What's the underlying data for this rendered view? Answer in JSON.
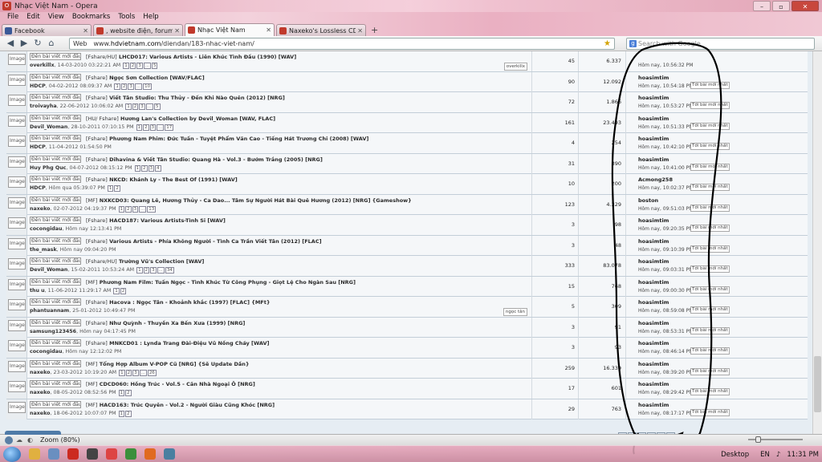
{
  "window": {
    "title": "Nhạc Việt Nam - Opera",
    "controls": {
      "minimize": "–",
      "maximize": "▫",
      "close": "✕"
    }
  },
  "menu": [
    "File",
    "Edit",
    "View",
    "Bookmarks",
    "Tools",
    "Help"
  ],
  "tabs": [
    {
      "label": "Facebook",
      "color": "#3b5998",
      "active": false
    },
    {
      "label": ", website điện, forum đ...",
      "color": "#c0392b",
      "active": false
    },
    {
      "label": "Nhạc Việt Nam",
      "color": "#c0392b",
      "active": true
    },
    {
      "label": "Naxeko's Lossless CDs ...",
      "color": "#c0392b",
      "active": false
    }
  ],
  "newtab": "+",
  "address": {
    "scheme_label": "Web",
    "url_prefix": "www.",
    "url_domain": "hdvietnam.com",
    "url_path": "/diendan/183-nhac-viet-nam/",
    "search_placeholder": "Search with Google"
  },
  "forum": {
    "new_post_label": "Đến bài viết mới đầu tiên",
    "last_post_box": "Tới bài mới nhất",
    "rows": [
      {
        "icon": "Image",
        "prefix": "[Fshare/HU]",
        "title": "LHCD017: Various Artists - Liên Khúc Tình Đầu (1990) [WAV]",
        "author": "overkillx",
        "date": "14-03-2010 03:22:21 AM",
        "pages": [
          "1",
          "2",
          "3",
          "...",
          "5"
        ],
        "tag": "overkillx",
        "replies": "45",
        "views": "6.337",
        "lp_user": "",
        "lp_time": "Hôm nay, 10:56:32 PM"
      },
      {
        "icon": "Image",
        "prefix": "[Fshare]",
        "title": "Ngọc Sơn Collection [WAV/FLAC]",
        "author": "HDCP",
        "date": "04-02-2012 08:09:37 AM",
        "pages": [
          "1",
          "2",
          "3",
          "...",
          "10"
        ],
        "tag": "",
        "replies": "90",
        "views": "12.092",
        "lp_user": "hoasimtim",
        "lp_time": "Hôm nay, 10:54:18 PM"
      },
      {
        "icon": "Image",
        "prefix": "[Fshare]",
        "title": "Viết Tân Studio: Thu Thủy - Đến Khi Nào Quên (2012) [NRG]",
        "author": "troivayha",
        "date": "22-06-2012 10:06:02 AM",
        "pages": [
          "1",
          "2",
          "3",
          "...",
          "5"
        ],
        "tag": "",
        "replies": "72",
        "views": "1.866",
        "lp_user": "hoasimtim",
        "lp_time": "Hôm nay, 10:53:27 PM"
      },
      {
        "icon": "Image",
        "prefix": "[HU/ Fshare]",
        "title": "Hương Lan's Collection by Devil_Woman [WAV, FLAC]",
        "author": "Devil_Woman",
        "date": "28-10-2011 07:10:15 PM",
        "pages": [
          "1",
          "2",
          "3",
          "...",
          "17"
        ],
        "tag": "",
        "replies": "161",
        "views": "23.493",
        "lp_user": "hoasimtim",
        "lp_time": "Hôm nay, 10:51:33 PM"
      },
      {
        "icon": "Image",
        "prefix": "[Fshare]",
        "title": "Phương Nam Phim: Đức Tuấn - Tuyệt Phẩm Văn Cao - Tiếng Hát Trương Chi (2008) [WAV]",
        "author": "HDCP",
        "date": "11-04-2012 01:54:50 PM",
        "pages": [],
        "tag": "",
        "replies": "4",
        "views": "254",
        "lp_user": "hoasimtim",
        "lp_time": "Hôm nay, 10:42:10 PM"
      },
      {
        "icon": "Image",
        "prefix": "[Fshare]",
        "title": "Dihavina & Viết Tân Studio: Quang Hà - Vol.3 - Bướm Trắng (2005) [NRG]",
        "author": "Huy Phg Quc",
        "date": "04-07-2012 08:15:12 PM",
        "pages": [
          "1",
          "2",
          "3",
          "4"
        ],
        "tag": "",
        "replies": "31",
        "views": "390",
        "lp_user": "hoasimtim",
        "lp_time": "Hôm nay, 10:41:00 PM"
      },
      {
        "icon": "Image",
        "prefix": "[Fshare]",
        "title": "NKCD: Khánh Ly - The Best Of (1991) [WAV]",
        "author": "HDCP",
        "date": "Hôm qua 05:39:07 PM",
        "pages": [
          "1",
          "2"
        ],
        "tag": "",
        "replies": "10",
        "views": "200",
        "lp_user": "Acmong258",
        "lp_time": "Hôm nay, 10:02:37 PM"
      },
      {
        "icon": "Image",
        "prefix": "[MF]",
        "title": "NXKCD03: Quang Lê, Hương Thủy - Ca Dao... Tâm Sự Người Hát Bài Quê Hương (2012) [NRG] {Gameshow}",
        "author": "naxeko",
        "date": "02-07-2012 04:19:37 PM",
        "pages": [
          "1",
          "2",
          "3",
          "...",
          "13"
        ],
        "tag": "",
        "replies": "123",
        "views": "4.329",
        "lp_user": "boston",
        "lp_time": "Hôm nay, 09:51:03 PM"
      },
      {
        "icon": "Image",
        "prefix": "[Fshare]",
        "title": "HACD187: Various Artists-Tình Si [WAV]",
        "author": "cocongidau",
        "date": "Hôm nay 12:13:41 PM",
        "pages": [],
        "tag": "",
        "replies": "3",
        "views": "98",
        "lp_user": "hoasimtim",
        "lp_time": "Hôm nay, 09:20:35 PM"
      },
      {
        "icon": "Image",
        "prefix": "[Fshare]",
        "title": "Various Artists - Phía Không Người - Tình Ca Trần Viết Tân (2012) [FLAC]",
        "author": "the_mask",
        "date": "Hôm nay 09:04:20 PM",
        "pages": [],
        "tag": "",
        "replies": "3",
        "views": "48",
        "lp_user": "hoasimtim",
        "lp_time": "Hôm nay, 09:10:39 PM"
      },
      {
        "icon": "Image",
        "prefix": "[Fshare/HU]",
        "title": "Trường Vũ's Collection [WAV]",
        "author": "Devil_Woman",
        "date": "15-02-2011 10:53:24 AM",
        "pages": [
          "1",
          "2",
          "3",
          "...",
          "34"
        ],
        "tag": "",
        "replies": "333",
        "views": "83.078",
        "lp_user": "hoasimtim",
        "lp_time": "Hôm nay, 09:03:31 PM"
      },
      {
        "icon": "Image",
        "prefix": "[MF]",
        "title": "Phương Nam Film: Tuấn Ngọc - Tình Khúc Từ Công Phụng - Giọt Lệ Cho Ngàn Sau [NRG]",
        "author": "thu u",
        "date": "11-06-2012 11:29:17 AM",
        "pages": [
          "1",
          "2"
        ],
        "tag": "",
        "replies": "15",
        "views": "768",
        "lp_user": "hoasimtim",
        "lp_time": "Hôm nay, 09:00:30 PM"
      },
      {
        "icon": "Image",
        "prefix": "[Fshare]",
        "title": "Hacova : Ngọc Tân - Khoảnh khắc (1997) [FLAC] {MFt}",
        "author": "phantuannam",
        "date": "25-01-2012 10:49:47 PM",
        "pages": [],
        "tag": "ngọc tân",
        "replies": "5",
        "views": "309",
        "lp_user": "hoasimtim",
        "lp_time": "Hôm nay, 08:59:08 PM"
      },
      {
        "icon": "Image",
        "prefix": "[Fshare]",
        "title": "Như Quỳnh - Thuyền Xa Bến Xưa (1999) [NRG]",
        "author": "samsung123456",
        "date": "Hôm nay 04:17:45 PM",
        "pages": [],
        "tag": "",
        "replies": "3",
        "views": "91",
        "lp_user": "hoasimtim",
        "lp_time": "Hôm nay, 08:53:31 PM"
      },
      {
        "icon": "Image",
        "prefix": "[Fshare]",
        "title": "MNKCD01 : Lynda Trang Đài-Điệu Vũ Nồng Cháy [WAV]",
        "author": "cocongidau",
        "date": "Hôm nay 12:12:02 PM",
        "pages": [],
        "tag": "",
        "replies": "3",
        "views": "93",
        "lp_user": "hoasimtim",
        "lp_time": "Hôm nay, 08:46:14 PM"
      },
      {
        "icon": "Image",
        "prefix": "[MF]",
        "title": "Tổng Hợp Album V-POP Cũ [NRG] {Sẽ Update Dần}",
        "author": "naxeko",
        "date": "23-03-2012 10:19:20 AM",
        "pages": [
          "1",
          "2",
          "3",
          "...",
          "26"
        ],
        "tag": "",
        "replies": "259",
        "views": "16.339",
        "lp_user": "hoasimtim",
        "lp_time": "Hôm nay, 08:39:20 PM"
      },
      {
        "icon": "Image",
        "prefix": "[MF]",
        "title": "CDCD060: Hồng Trúc - Vol.5 - Căn Nhà Ngoại Ô [NRG]",
        "author": "naxeko",
        "date": "08-05-2012 08:52:56 PM",
        "pages": [
          "1",
          "2"
        ],
        "tag": "",
        "replies": "17",
        "views": "601",
        "lp_user": "hoasimtim",
        "lp_time": "Hôm nay, 08:29:42 PM"
      },
      {
        "icon": "Image",
        "prefix": "[MF]",
        "title": "HACD163: Trúc Quyên - Vol.2 - Người Giàu Cũng Khóc [NRG]",
        "author": "naxeko",
        "date": "18-06-2012 10:07:07 PM",
        "pages": [
          "1",
          "2"
        ],
        "tag": "",
        "replies": "29",
        "views": "763",
        "lp_user": "hoasimtim",
        "lp_time": "Hôm nay, 08:17:17 PM"
      }
    ]
  },
  "status": {
    "zoom": "Zoom (80%)"
  },
  "taskbar": {
    "desktop": "Desktop",
    "lang": "EN",
    "time": "11:31 PM",
    "apps": [
      {
        "name": "explorer",
        "color": "#e0b040"
      },
      {
        "name": "media",
        "color": "#6a8fc0"
      },
      {
        "name": "opera",
        "color": "#cc2a20"
      },
      {
        "name": "app",
        "color": "#444"
      },
      {
        "name": "browser",
        "color": "#d44"
      },
      {
        "name": "chrome",
        "color": "#3b8f3b"
      },
      {
        "name": "firefox",
        "color": "#e06a20"
      },
      {
        "name": "network",
        "color": "#4a7fa0"
      }
    ]
  }
}
